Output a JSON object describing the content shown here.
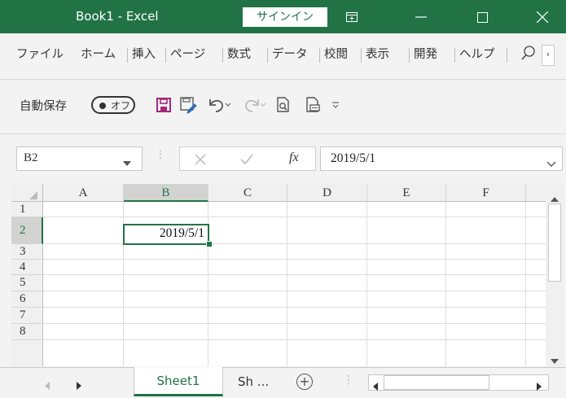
{
  "window": {
    "title": "Book1  -  Excel",
    "signin_label": "サインイン",
    "accent_color": "#217346"
  },
  "ribbon_tabs": [
    "ファイル",
    "ホーム",
    "挿入",
    "ページ",
    "数式",
    "データ",
    "校閲",
    "表示",
    "開発",
    "ヘルプ"
  ],
  "qat": {
    "autosave_label": "自動保存",
    "autosave_toggle": "オフ",
    "icons": [
      "save-icon",
      "save-as-icon",
      "undo-icon",
      "redo-icon",
      "print-preview-icon",
      "print-icon",
      "customize-qat-icon"
    ]
  },
  "formula_bar": {
    "name_box": "B2",
    "fx_label": "fx",
    "value": "2019/5/1"
  },
  "grid": {
    "columns": [
      "A",
      "B",
      "C",
      "D",
      "E",
      "F"
    ],
    "rows": [
      "1",
      "2",
      "3",
      "4",
      "5",
      "6",
      "7",
      "8"
    ],
    "selected_column": "B",
    "selected_row": "2",
    "active_cell": {
      "ref": "B2",
      "value": "2019/5/1"
    }
  },
  "sheets": {
    "active": "Sheet1",
    "next_truncated": "Sh ..."
  }
}
